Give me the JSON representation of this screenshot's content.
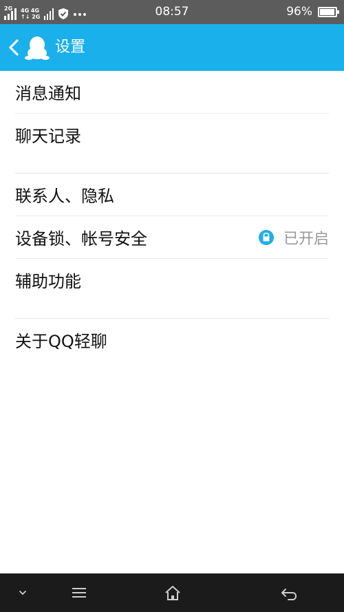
{
  "status_bar": {
    "signal1_tag": "2G",
    "network_top": "4G 4G",
    "network_bottom": "↑↓ 2G",
    "time": "08:57",
    "battery_percent": "96%",
    "battery_level": 0.96
  },
  "header": {
    "title": "设置"
  },
  "groups": [
    {
      "items": [
        {
          "label": "消息通知"
        },
        {
          "label": "聊天记录"
        }
      ]
    },
    {
      "items": [
        {
          "label": "联系人、隐私"
        },
        {
          "label": "设备锁、帐号安全",
          "status": "已开启"
        },
        {
          "label": "辅助功能"
        }
      ]
    },
    {
      "items": [
        {
          "label": "关于QQ轻聊"
        }
      ]
    }
  ],
  "colors": {
    "header_bg": "#1ab0ec",
    "status_bar_bg": "#5c5c5c",
    "nav_bg": "#1b1b1b",
    "accent": "#22aeea"
  }
}
